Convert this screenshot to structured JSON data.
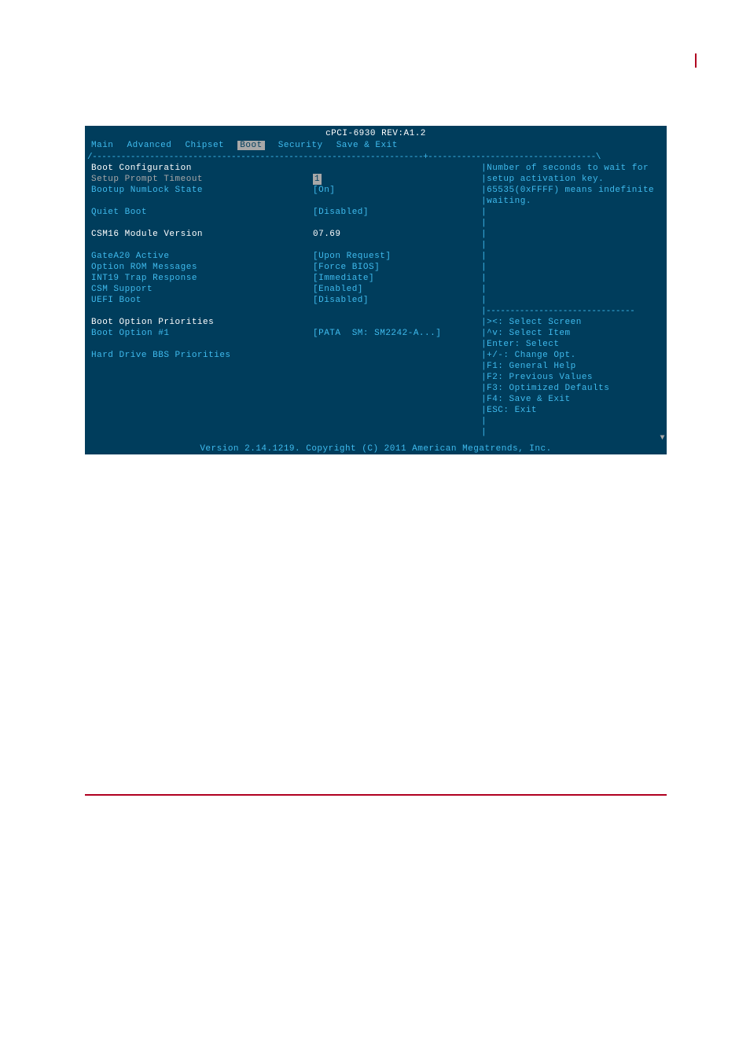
{
  "title": "cPCI-6930 REV:A1.2",
  "menu": {
    "items": [
      "Main",
      "Advanced",
      "Chipset",
      "Boot",
      "Security",
      "Save & Exit"
    ],
    "selected_index": 3
  },
  "left": {
    "section1": "Boot Configuration",
    "setup_prompt_label": "Setup Prompt Timeout",
    "setup_prompt_value": "1",
    "numlock_label": "Bootup NumLock State",
    "numlock_value": "[On]",
    "quiet_label": "Quiet Boot",
    "quiet_value": "[Disabled]",
    "csm16_label": "CSM16 Module Version",
    "csm16_value": "07.69",
    "gatea20_label": "GateA20 Active",
    "gatea20_value": "[Upon Request]",
    "optrom_label": "Option ROM Messages",
    "optrom_value": "[Force BIOS]",
    "int19_label": "INT19 Trap Response",
    "int19_value": "[Immediate]",
    "csmsupport_label": "CSM Support",
    "csmsupport_value": "[Enabled]",
    "uefi_label": "UEFI Boot",
    "uefi_value": "[Disabled]",
    "priorities_label": "Boot Option Priorities",
    "boot1_label": "Boot Option #1",
    "boot1_value": "[PATA  SM: SM2242-A...]",
    "hdd_bbs_label": "Hard Drive BBS Priorities"
  },
  "help": {
    "line1": "Number of seconds to wait for",
    "line2": "setup activation key.",
    "line3": "65535(0xFFFF) means indefinite",
    "line4": "waiting.",
    "k1": "><: Select Screen",
    "k2": "^v: Select Item",
    "k3": "Enter: Select",
    "k4": "+/-: Change Opt.",
    "k5": "F1: General Help",
    "k6": "F2: Previous Values",
    "k7": "F3: Optimized Defaults",
    "k8": "F4: Save & Exit",
    "k9": "ESC: Exit"
  },
  "footer": "Version 2.14.1219. Copyright (C) 2011 American Megatrends, Inc."
}
